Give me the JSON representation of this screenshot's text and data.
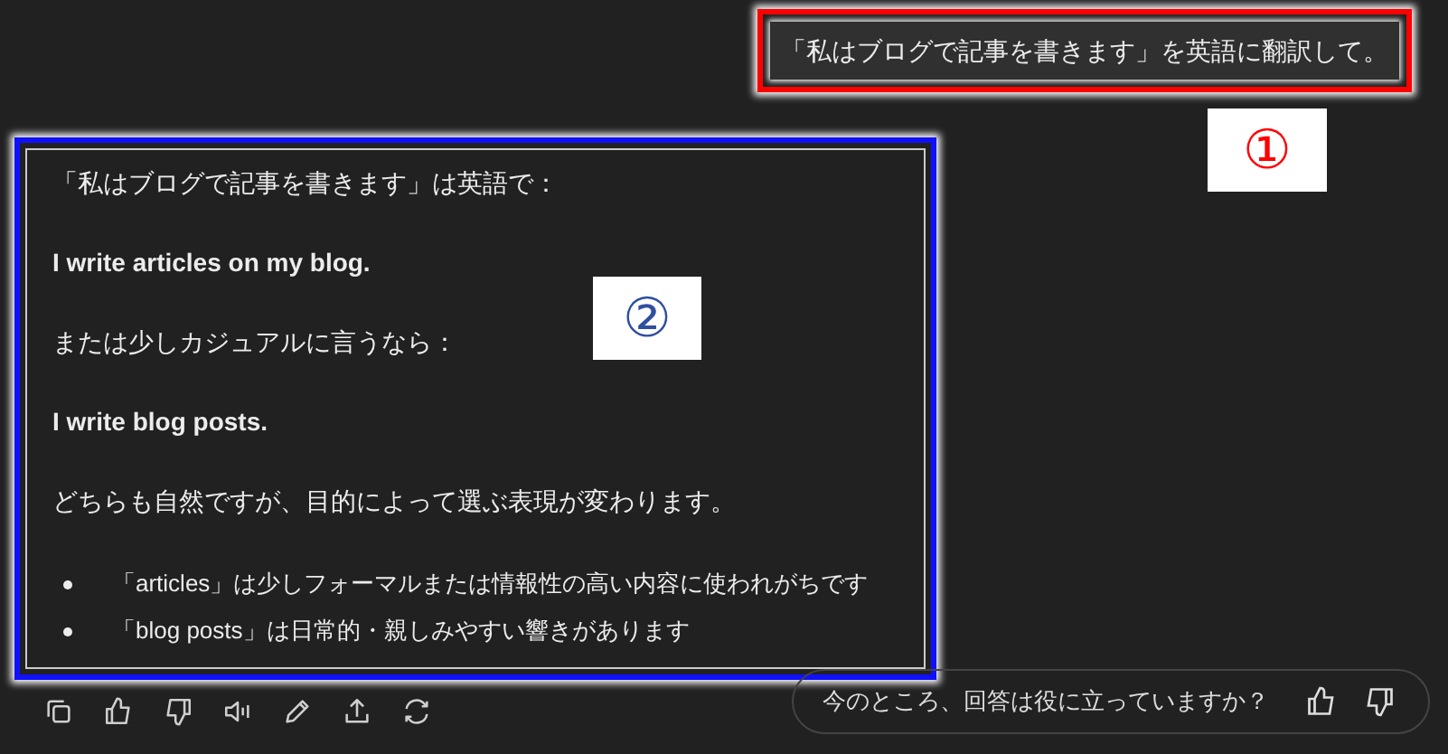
{
  "user_message": {
    "text": "「私はブログで記事を書きます」を英語に翻訳して。"
  },
  "callouts": [
    {
      "label": "①",
      "color": "#ff0000"
    },
    {
      "label": "②",
      "color": "#2f4f9f"
    }
  ],
  "response": {
    "blocks": [
      {
        "kind": "text",
        "text": "「私はブログで記事を書きます」は英語で："
      },
      {
        "kind": "bold",
        "text": "I write articles on my blog."
      },
      {
        "kind": "text",
        "text": "または少しカジュアルに言うなら："
      },
      {
        "kind": "bold",
        "text": "I write blog posts."
      },
      {
        "kind": "text",
        "text": "どちらも自然ですが、目的によって選ぶ表現が変わります。"
      },
      {
        "kind": "bullets",
        "items": [
          "「articles」は少しフォーマルまたは情報性の高い内容に使われがちです",
          "「blog posts」は日常的・親しみやすい響きがあります"
        ]
      }
    ]
  },
  "feedback": {
    "prompt": "今のところ、回答は役に立っていますか？"
  }
}
